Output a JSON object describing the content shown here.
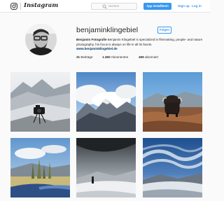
{
  "header": {
    "wordmark": "Instagram",
    "search_placeholder": "Suchen",
    "app_button_label": "App installieren",
    "signup_label": "Sign up",
    "login_label": "Log in"
  },
  "profile": {
    "username": "benjaminklingebiel",
    "follow_label": "Folgen",
    "bio_name": "Benjamin Fotografie",
    "bio_text": " Benjamin Klingebiel is specialized in filmmaking, people- and nature photography, his focus is always on life in all its facets.",
    "website": "www.benjaminklingebiel.de",
    "stats": {
      "posts_count": "31",
      "posts_label": " Beiträge",
      "followers_count": "1.360",
      "followers_label": " Abonnenten",
      "following_count": "469",
      "following_label": " abonniert"
    }
  },
  "posts": [
    {
      "id": "post-1",
      "subject": "camera on snowy mountain"
    },
    {
      "id": "post-2",
      "subject": "mountains and clouds"
    },
    {
      "id": "post-3",
      "subject": "musk ox in tundra"
    },
    {
      "id": "post-4",
      "subject": "river valley with trees"
    },
    {
      "id": "post-5",
      "subject": "person on snowy slope"
    },
    {
      "id": "post-6",
      "subject": "dramatic sky over snowy landscape"
    }
  ],
  "colors": {
    "accent": "#3897f0",
    "link": "#003569",
    "background": "#fafafa"
  },
  "icons": {
    "logo": "instagram-camera-icon",
    "search": "search-icon"
  }
}
